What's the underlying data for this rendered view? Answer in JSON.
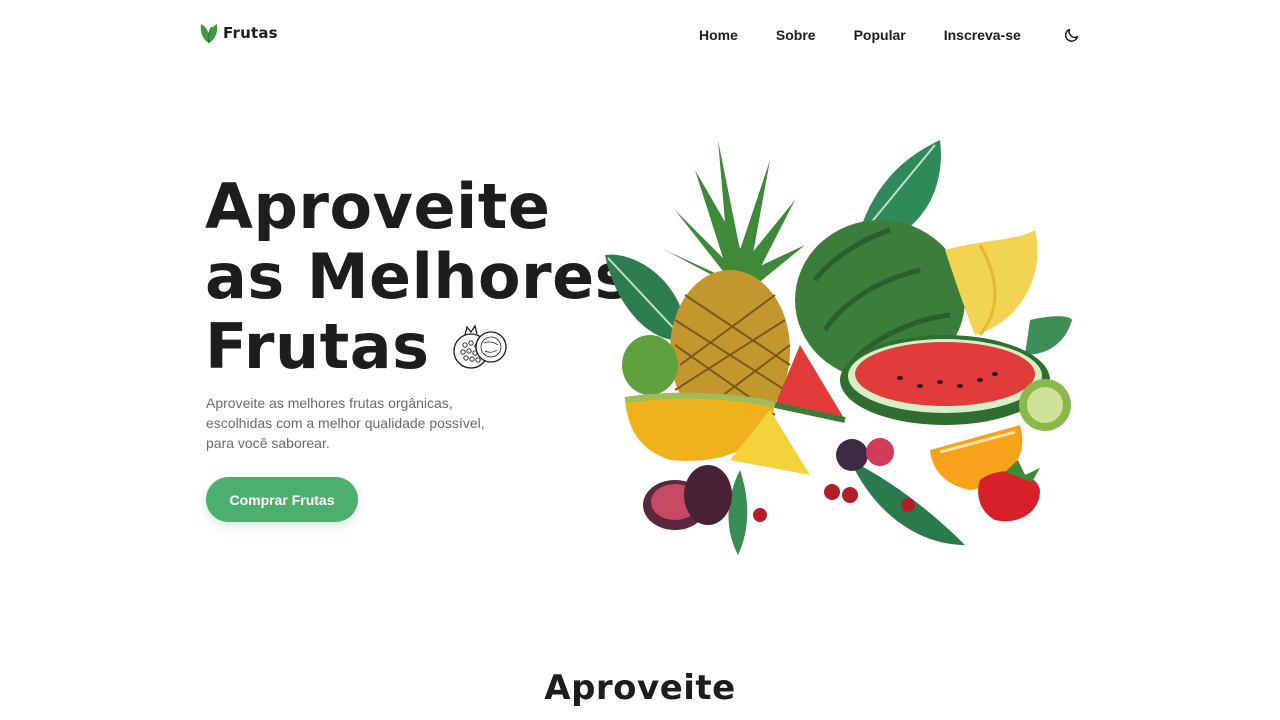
{
  "header": {
    "logo_text": "Frutas",
    "nav": [
      "Home",
      "Sobre",
      "Popular",
      "Inscreva-se"
    ],
    "theme_icon": "moon-icon"
  },
  "hero": {
    "title_lines": [
      "Aproveite",
      "as Melhores",
      "Frutas"
    ],
    "description": "Aproveite as melhores frutas orgânicas, escolhidas com a melhor qualidade possível, para você saborear.",
    "button_label": "Comprar Frutas",
    "image_icon": "fruit-bowl-illustration",
    "sketch_icon": "pomegranate-sketch-icon"
  },
  "next_section": {
    "title": "Aproveite"
  },
  "colors": {
    "accent": "#4caf6e",
    "text": "#1d1d1d",
    "muted": "#6b6b6b",
    "background": "#ffffff"
  }
}
